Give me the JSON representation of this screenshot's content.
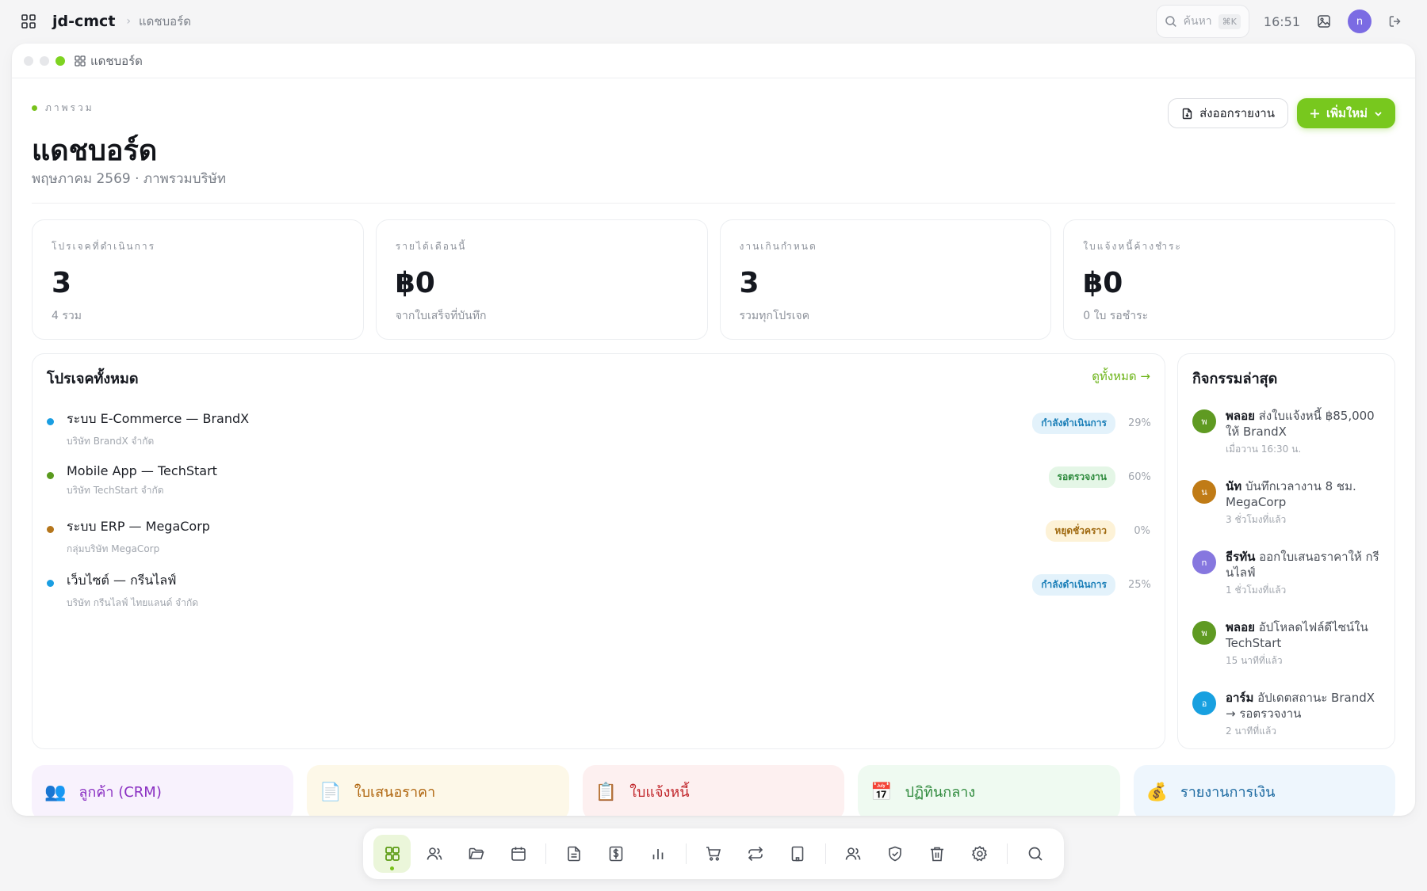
{
  "topbar": {
    "app_name": "jd-cmct",
    "breadcrumb": "แดชบอร์ด",
    "search_placeholder": "ค้นหา",
    "shortcut": "⌘K",
    "time": "16:51",
    "avatar_initial": "n"
  },
  "window": {
    "title": "แดชบอร์ด"
  },
  "header": {
    "overline": "ภาพรวม",
    "title": "แดชบอร์ด",
    "subtitle": "พฤษภาคม 2569 · ภาพรวมบริษัท",
    "export_label": "ส่งออกรายงาน",
    "add_label": "เพิ่มใหม่"
  },
  "stats": [
    {
      "label": "โปรเจคที่ดำเนินการ",
      "value": "3",
      "sub": "4 รวม"
    },
    {
      "label": "รายได้เดือนนี้",
      "value": "฿0",
      "sub": "จากใบเสร็จที่บันทึก"
    },
    {
      "label": "งานเกินกำหนด",
      "value": "3",
      "sub": "รวมทุกโปรเจค"
    },
    {
      "label": "ใบแจ้งหนี้ค้างชำระ",
      "value": "฿0",
      "sub": "0 ใบ รอชำระ"
    }
  ],
  "projects": {
    "title": "โปรเจคทั้งหมด",
    "view_all": "ดูทั้งหมด →",
    "items": [
      {
        "name": "ระบบ E-Commerce — BrandX",
        "client": "บริษัท BrandX จำกัด",
        "status": "กำลังดำเนินการ",
        "progress": "29%",
        "dot_color": "#1a9ee2",
        "badge_bg": "#e3f2fb",
        "badge_fg": "#1b7fb8"
      },
      {
        "name": "Mobile App — TechStart",
        "client": "บริษัท TechStart จำกัด",
        "status": "รอตรวจงาน",
        "progress": "60%",
        "dot_color": "#5a9a1e",
        "badge_bg": "#e4f6e6",
        "badge_fg": "#2d8a3c"
      },
      {
        "name": "ระบบ ERP — MegaCorp",
        "client": "กลุ่มบริษัท MegaCorp",
        "status": "หยุดชั่วคราว",
        "progress": "0%",
        "dot_color": "#b5761c",
        "badge_bg": "#fdf2d7",
        "badge_fg": "#a06a10"
      },
      {
        "name": "เว็บไซต์ — กรีนไลฟ์",
        "client": "บริษัท กรีนไลฟ์ ไทยแลนด์ จำกัด",
        "status": "กำลังดำเนินการ",
        "progress": "25%",
        "dot_color": "#1a9ee2",
        "badge_bg": "#e3f2fb",
        "badge_fg": "#1b7fb8"
      }
    ]
  },
  "activity": {
    "title": "กิจกรรมล่าสุด",
    "items": [
      {
        "initial": "พ",
        "color": "#5f9a22",
        "user": "พลอย",
        "text": "ส่งใบแจ้งหนี้ ฿85,000 ให้ BrandX",
        "time": "เมื่อวาน 16:30 น."
      },
      {
        "initial": "น",
        "color": "#c07b16",
        "user": "นัท",
        "text": "บันทึกเวลางาน 8 ชม. MegaCorp",
        "time": "3 ชั่วโมงที่แล้ว"
      },
      {
        "initial": "n",
        "color": "#8677df",
        "user": "ธีรทัน",
        "text": "ออกใบเสนอราคาให้ กรีนไลฟ์",
        "time": "1 ชั่วโมงที่แล้ว"
      },
      {
        "initial": "พ",
        "color": "#5f9a22",
        "user": "พลอย",
        "text": "อัปโหลดไฟล์ดีไซน์ใน TechStart",
        "time": "15 นาทีที่แล้ว"
      },
      {
        "initial": "อ",
        "color": "#18a0e0",
        "user": "อาร์ม",
        "text": "อัปเดตสถานะ BrandX → รอตรวจงาน",
        "time": "2 นาทีที่แล้ว"
      }
    ]
  },
  "shortcuts": [
    {
      "icon": "👥",
      "label": "ลูกค้า (CRM)",
      "bg": "#f8f2fd",
      "fg": "#8a2fc2"
    },
    {
      "icon": "📄",
      "label": "ใบเสนอราคา",
      "bg": "#fdf8e8",
      "fg": "#b0660f"
    },
    {
      "icon": "📋",
      "label": "ใบแจ้งหนี้",
      "bg": "#fdf0f0",
      "fg": "#c1262b"
    },
    {
      "icon": "📅",
      "label": "ปฏิทินกลาง",
      "bg": "#effaf1",
      "fg": "#2f8a3d"
    },
    {
      "icon": "💰",
      "label": "รายงานการเงิน",
      "bg": "#eef6fd",
      "fg": "#1d6aa1"
    }
  ],
  "dock": {
    "icons": [
      "dashboard-icon",
      "customers-icon",
      "folder-icon",
      "calendar-icon",
      "document-icon",
      "invoice-icon",
      "bar-chart-icon",
      "cart-icon",
      "transfer-icon",
      "building-icon",
      "team-icon",
      "shield-icon",
      "trash-icon",
      "settings-icon",
      "search-icon"
    ]
  }
}
